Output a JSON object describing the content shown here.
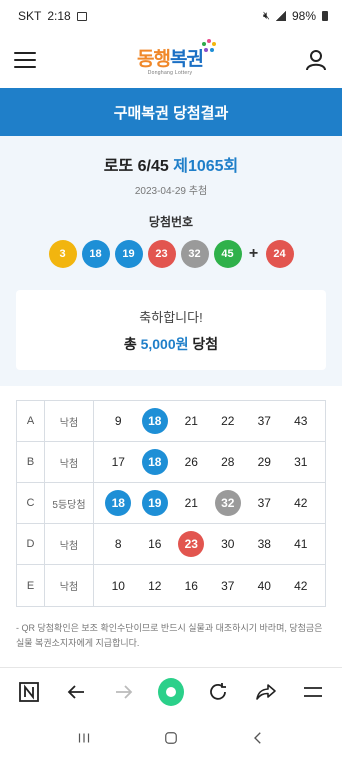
{
  "status_bar": {
    "carrier": "SKT",
    "time": "2:18",
    "battery": "98%"
  },
  "header": {
    "logo_parts": [
      "동행",
      "복권"
    ],
    "logo_sub": "Donghang Lottery"
  },
  "banner": {
    "title": "구매복권 당첨결과"
  },
  "result": {
    "game_prefix": "로또 6/45",
    "round": "제1065회",
    "draw_date": "2023-04-29 추첨",
    "win_numbers_label": "당첨번호",
    "balls": [
      {
        "n": "3",
        "color": "#f2b50f"
      },
      {
        "n": "18",
        "color": "#1e8fd6"
      },
      {
        "n": "19",
        "color": "#1e8fd6"
      },
      {
        "n": "23",
        "color": "#e2554f"
      },
      {
        "n": "32",
        "color": "#9a9a9a"
      },
      {
        "n": "45",
        "color": "#2fb14a"
      }
    ],
    "plus": "+",
    "bonus": {
      "n": "24",
      "color": "#e2554f"
    },
    "congrats": "축하합니다!",
    "prize_prefix": "총",
    "prize_amount": "5,000원",
    "prize_suffix": "당첨"
  },
  "ticket": {
    "rows": [
      {
        "letter": "A",
        "result": "낙첨",
        "nums": [
          {
            "n": "9",
            "hit": false
          },
          {
            "n": "18",
            "hit": true,
            "color": "#1e8fd6"
          },
          {
            "n": "21",
            "hit": false
          },
          {
            "n": "22",
            "hit": false
          },
          {
            "n": "37",
            "hit": false
          },
          {
            "n": "43",
            "hit": false
          }
        ]
      },
      {
        "letter": "B",
        "result": "낙첨",
        "nums": [
          {
            "n": "17",
            "hit": false
          },
          {
            "n": "18",
            "hit": true,
            "color": "#1e8fd6"
          },
          {
            "n": "26",
            "hit": false
          },
          {
            "n": "28",
            "hit": false
          },
          {
            "n": "29",
            "hit": false
          },
          {
            "n": "31",
            "hit": false
          }
        ]
      },
      {
        "letter": "C",
        "result": "5등당첨",
        "nums": [
          {
            "n": "18",
            "hit": true,
            "color": "#1e8fd6"
          },
          {
            "n": "19",
            "hit": true,
            "color": "#1e8fd6"
          },
          {
            "n": "21",
            "hit": false
          },
          {
            "n": "32",
            "hit": true,
            "color": "#9a9a9a"
          },
          {
            "n": "37",
            "hit": false
          },
          {
            "n": "42",
            "hit": false
          }
        ]
      },
      {
        "letter": "D",
        "result": "낙첨",
        "nums": [
          {
            "n": "8",
            "hit": false
          },
          {
            "n": "16",
            "hit": false
          },
          {
            "n": "23",
            "hit": true,
            "color": "#e2554f"
          },
          {
            "n": "30",
            "hit": false
          },
          {
            "n": "38",
            "hit": false
          },
          {
            "n": "41",
            "hit": false
          }
        ]
      },
      {
        "letter": "E",
        "result": "낙첨",
        "nums": [
          {
            "n": "10",
            "hit": false
          },
          {
            "n": "12",
            "hit": false
          },
          {
            "n": "16",
            "hit": false
          },
          {
            "n": "37",
            "hit": false
          },
          {
            "n": "40",
            "hit": false
          },
          {
            "n": "42",
            "hit": false
          }
        ]
      }
    ]
  },
  "notice": "- QR 당첨확인은 보조 확인수단이므로 반드시 실물과 대조하시기 바라며, 당첨금은 실물 복권소지자에게 지급합니다.",
  "browser_toolbar": {
    "icons": [
      "naver-icon",
      "back-arrow-icon",
      "forward-arrow-icon",
      "home-dot-icon",
      "refresh-icon",
      "share-icon",
      "menu-icon"
    ]
  },
  "colors": {
    "accent": "#1f7fc9",
    "home": "#2bd08a"
  }
}
